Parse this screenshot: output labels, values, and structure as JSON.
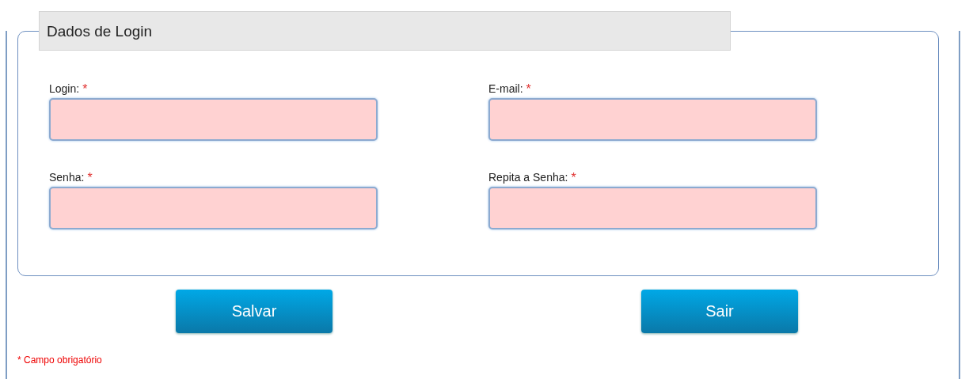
{
  "fieldset": {
    "legend": "Dados de Login",
    "fields": [
      {
        "label": "Login:",
        "required_mark": "*"
      },
      {
        "label": "E-mail:",
        "required_mark": "*"
      },
      {
        "label": "Senha:",
        "required_mark": "*"
      },
      {
        "label": "Repita a Senha:",
        "required_mark": "*"
      }
    ]
  },
  "buttons": [
    "Salvar",
    "Sair"
  ],
  "footnote": {
    "mark": "*",
    "text": "Campo obrigatório"
  }
}
